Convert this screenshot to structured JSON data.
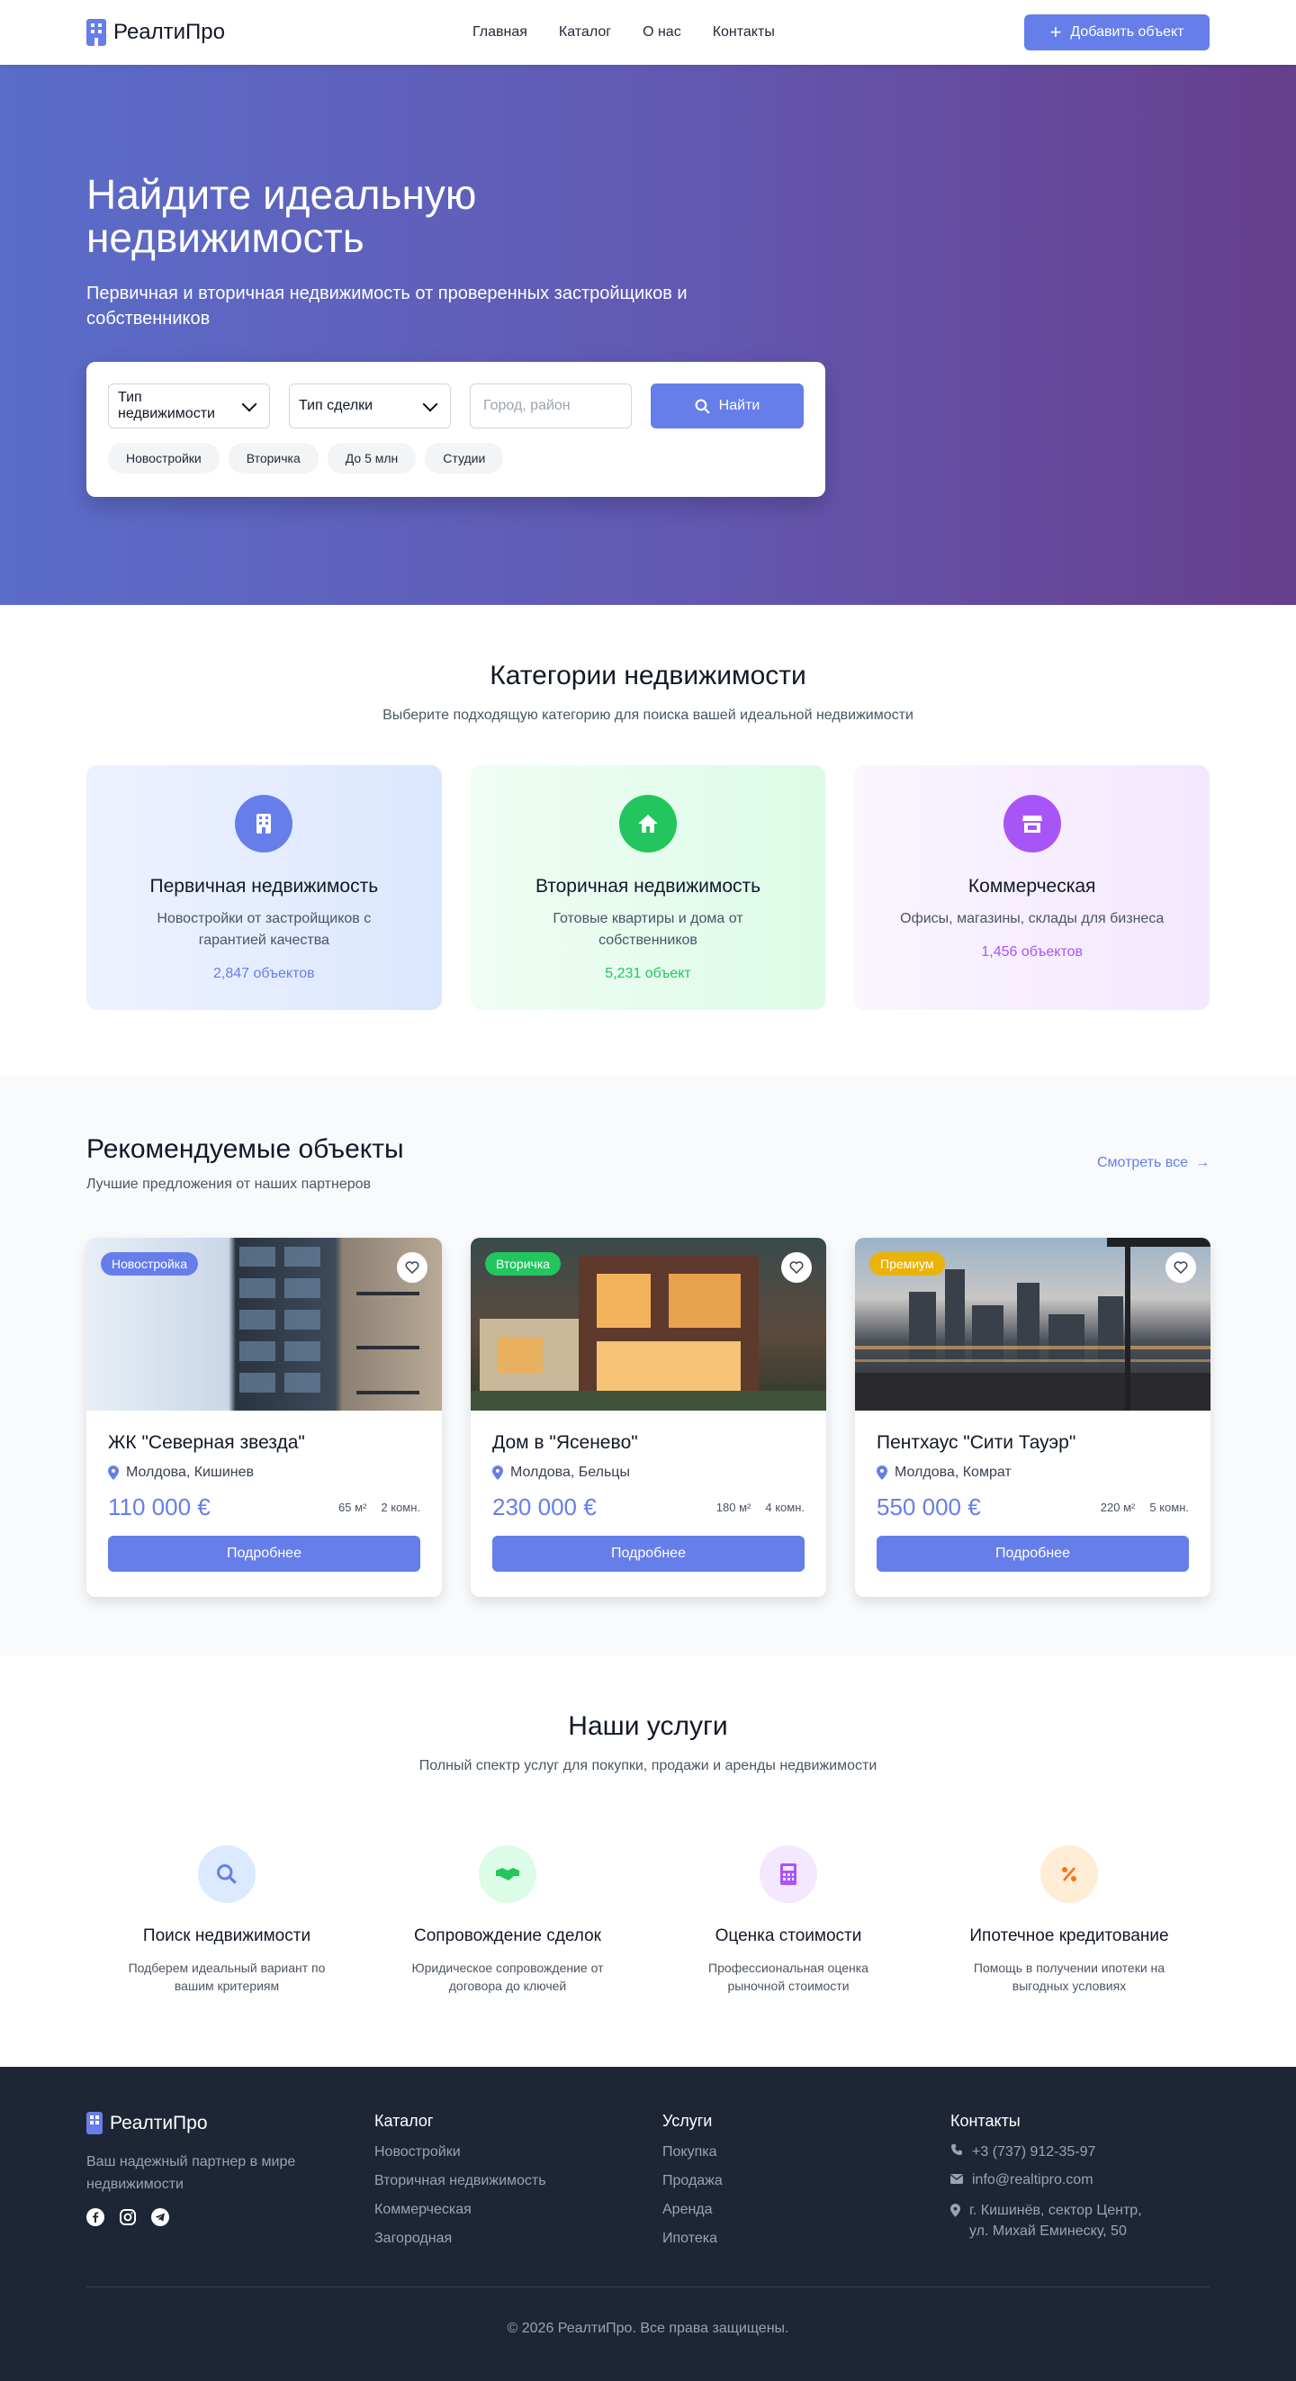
{
  "header": {
    "brand": "РеалтиПро",
    "nav": [
      "Главная",
      "Каталог",
      "О нас",
      "Контакты"
    ],
    "add_button": "Добавить объект"
  },
  "hero": {
    "title": "Найдите идеальную недвижимость",
    "subtitle": "Первичная и вторичная недвижимость от проверенных застройщиков и собственников",
    "search": {
      "type_select": "Тип недвижимости",
      "deal_select": "Тип сделки",
      "city_placeholder": "Город, район",
      "find_button": "Найти",
      "chips": [
        "Новостройки",
        "Вторичка",
        "До 5 млн",
        "Студии"
      ]
    }
  },
  "categories": {
    "title": "Категории недвижимости",
    "subtitle": "Выберите подходящую категорию для поиска вашей идеальной недвижимости",
    "items": [
      {
        "title": "Первичная недвижимость",
        "desc": "Новостройки от застройщиков с гарантией качества",
        "count": "2,847 объектов",
        "color": "#667eea",
        "icon": "building-icon"
      },
      {
        "title": "Вторичная недвижимость",
        "desc": "Готовые квартиры и дома от собственников",
        "count": "5,231 объект",
        "color": "#22c55e",
        "icon": "home-icon"
      },
      {
        "title": "Коммерческая",
        "desc": "Офисы, магазины, склады для бизнеса",
        "count": "1,456 объектов",
        "color": "#a855f7",
        "icon": "store-icon"
      }
    ]
  },
  "featured": {
    "title": "Рекомендуемые объекты",
    "subtitle": "Лучшие предложения от наших партнеров",
    "see_all": "Смотреть все",
    "items": [
      {
        "badge": "Новостройка",
        "badge_color": "#667eea",
        "title": "ЖК \"Северная звезда\"",
        "location": "Молдова, Кишинев",
        "price": "110 000 €",
        "area": "65 м²",
        "rooms": "2 комн.",
        "button": "Подробнее"
      },
      {
        "badge": "Вторичка",
        "badge_color": "#22c55e",
        "title": "Дом в \"Ясеневo\"",
        "location": "Молдова, Бельцы",
        "price": "230 000 €",
        "area": "180 м²",
        "rooms": "4 комн.",
        "button": "Подробнее"
      },
      {
        "badge": "Премиум",
        "badge_color": "#eab308",
        "title": "Пентхаус \"Сити Тауэр\"",
        "location": "Молдова, Комрат",
        "price": "550 000 €",
        "area": "220 м²",
        "rooms": "5 комн.",
        "button": "Подробнее"
      }
    ]
  },
  "services": {
    "title": "Наши услуги",
    "subtitle": "Полный спектр услуг для покупки, продажи и аренды недвижимости",
    "items": [
      {
        "title": "Поиск недвижимости",
        "desc": "Подберем идеальный вариант по вашим критериям",
        "icon": "search-icon"
      },
      {
        "title": "Сопровождение сделок",
        "desc": "Юридическое сопровождение от договора до ключей",
        "icon": "handshake-icon"
      },
      {
        "title": "Оценка стоимости",
        "desc": "Профессиональная оценка рыночной стоимости",
        "icon": "calculator-icon"
      },
      {
        "title": "Ипотечное кредитование",
        "desc": "Помощь в получении ипотеки на выгодных условиях",
        "icon": "percent-icon"
      }
    ]
  },
  "footer": {
    "brand": "РеалтиПро",
    "tagline": "Ваш надежный партнер в мире недвижимости",
    "catalog": {
      "title": "Каталог",
      "links": [
        "Новостройки",
        "Вторичная недвижимость",
        "Коммерческая",
        "Загородная"
      ]
    },
    "services": {
      "title": "Услуги",
      "links": [
        "Покупка",
        "Продажа",
        "Аренда",
        "Ипотека"
      ]
    },
    "contacts": {
      "title": "Контакты",
      "phone": "+3 (737) 912-35-97",
      "email": "info@realtipro.com",
      "address": "г. Кишинёв, сектор Центр, ул. Михай Еминеску, 50"
    },
    "copyright": "© 2026 РеалтиПро. Все права защищены."
  }
}
